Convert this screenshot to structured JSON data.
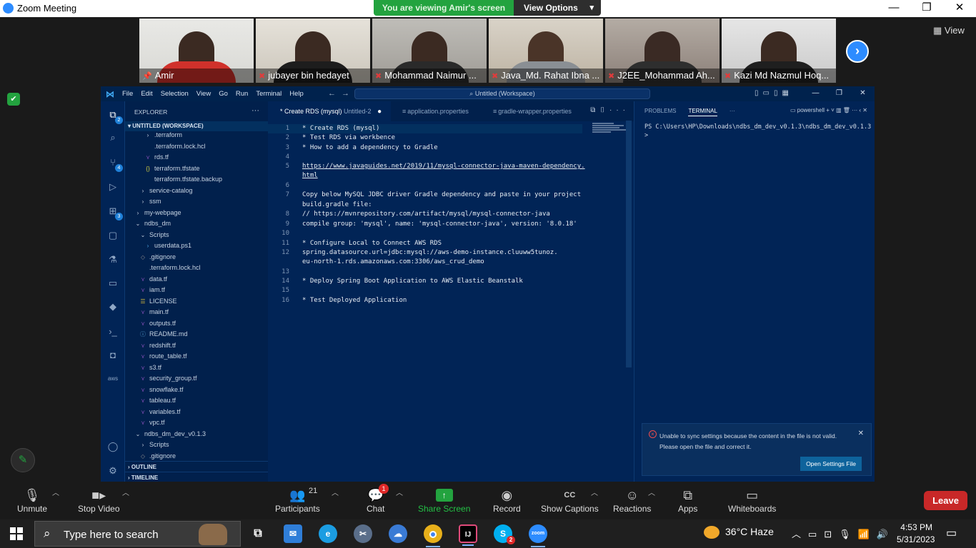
{
  "window": {
    "title": "Zoom Meeting",
    "controls": [
      "—",
      "❐",
      "✕"
    ]
  },
  "banner": {
    "viewing_text": "You are viewing Amir's screen",
    "view_options_label": "View Options"
  },
  "view_button": "View",
  "participants": [
    {
      "name": "Amir",
      "muted": false,
      "pinned": true
    },
    {
      "name": "jubayer bin hedayet",
      "muted": true
    },
    {
      "name": "Mohammad Naimur ...",
      "muted": true
    },
    {
      "name": "Java_Md. Rahat Ibna ...",
      "muted": true
    },
    {
      "name": "J2EE_Mohammad Ah...",
      "muted": true
    },
    {
      "name": "Kazi Md Nazmul Hoq...",
      "muted": true
    }
  ],
  "vscode": {
    "menu": [
      "File",
      "Edit",
      "Selection",
      "View",
      "Go",
      "Run",
      "Terminal",
      "Help"
    ],
    "command_center": "Untitled (Workspace)",
    "activity_badges": {
      "explorer": "2",
      "scm": "4",
      "extensions": "3"
    },
    "explorer_title": "EXPLORER",
    "workspace_section": "UNTITLED (WORKSPACE)",
    "tree": [
      {
        "label": ".terraform",
        "indent": 2,
        "icon": "chevron-right"
      },
      {
        "label": ".terraform.lock.hcl",
        "indent": 2,
        "icon": "file"
      },
      {
        "label": "rds.tf",
        "indent": 2,
        "icon": "terraform"
      },
      {
        "label": "terraform.tfstate",
        "indent": 2,
        "icon": "json"
      },
      {
        "label": "terraform.tfstate.backup",
        "indent": 2,
        "icon": "file"
      },
      {
        "label": "service-catalog",
        "indent": 1,
        "icon": "chevron-right"
      },
      {
        "label": "ssm",
        "indent": 1,
        "icon": "chevron-right"
      },
      {
        "label": "my-webpage",
        "indent": 0,
        "icon": "chevron-right"
      },
      {
        "label": "ndbs_dm",
        "indent": 0,
        "icon": "chevron-down"
      },
      {
        "label": "Scripts",
        "indent": 1,
        "icon": "chevron-down"
      },
      {
        "label": "userdata.ps1",
        "indent": 2,
        "icon": "powershell"
      },
      {
        "label": ".gitignore",
        "indent": 1,
        "icon": "git"
      },
      {
        "label": ".terraform.lock.hcl",
        "indent": 1,
        "icon": "file"
      },
      {
        "label": "data.tf",
        "indent": 1,
        "icon": "terraform"
      },
      {
        "label": "iam.tf",
        "indent": 1,
        "icon": "terraform"
      },
      {
        "label": "LICENSE",
        "indent": 1,
        "icon": "license"
      },
      {
        "label": "main.tf",
        "indent": 1,
        "icon": "terraform"
      },
      {
        "label": "outputs.tf",
        "indent": 1,
        "icon": "terraform"
      },
      {
        "label": "README.md",
        "indent": 1,
        "icon": "markdown"
      },
      {
        "label": "redshift.tf",
        "indent": 1,
        "icon": "terraform"
      },
      {
        "label": "route_table.tf",
        "indent": 1,
        "icon": "terraform"
      },
      {
        "label": "s3.tf",
        "indent": 1,
        "icon": "terraform"
      },
      {
        "label": "security_group.tf",
        "indent": 1,
        "icon": "terraform"
      },
      {
        "label": "snowflake.tf",
        "indent": 1,
        "icon": "terraform"
      },
      {
        "label": "tableau.tf",
        "indent": 1,
        "icon": "terraform"
      },
      {
        "label": "variables.tf",
        "indent": 1,
        "icon": "terraform"
      },
      {
        "label": "vpc.tf",
        "indent": 1,
        "icon": "terraform"
      },
      {
        "label": "ndbs_dm_dev_v0.1.3",
        "indent": 0,
        "icon": "chevron-down"
      },
      {
        "label": "Scripts",
        "indent": 1,
        "icon": "chevron-right"
      },
      {
        "label": ".gitignore",
        "indent": 1,
        "icon": "git"
      }
    ],
    "outline_label": "OUTLINE",
    "timeline_label": "TIMELINE",
    "tabs": [
      {
        "label": "* Create RDS (mysql)",
        "suffix": "Untitled-2",
        "active": true,
        "dirty": true
      },
      {
        "label": "application.properties",
        "active": false
      },
      {
        "label": "gradle-wrapper.properties",
        "active": false
      }
    ],
    "code_lines": [
      {
        "n": "1",
        "text": "* Create RDS (mysql)",
        "current": true
      },
      {
        "n": "2",
        "text": "* Test RDS via workbence"
      },
      {
        "n": "3",
        "text": "* How to add a dependency to Gradle"
      },
      {
        "n": "4",
        "text": ""
      },
      {
        "n": "5",
        "text": "https://www.javaguides.net/2019/11/mysql-connector-java-maven-dependency.",
        "link": true
      },
      {
        "n": "",
        "text": "html",
        "link": true
      },
      {
        "n": "6",
        "text": ""
      },
      {
        "n": "7",
        "text": "Copy below MySQL JDBC driver Gradle dependency and paste in your project"
      },
      {
        "n": "",
        "text": "build.gradle file:"
      },
      {
        "n": "8",
        "text": "// https://mvnrepository.com/artifact/mysql/mysql-connector-java",
        "comment_link": true
      },
      {
        "n": "9",
        "text": "compile group: 'mysql', name: 'mysql-connector-java', version: '8.0.18'"
      },
      {
        "n": "10",
        "text": ""
      },
      {
        "n": "11",
        "text": "* Configure Local to Connect AWS RDS"
      },
      {
        "n": "12",
        "text": "spring.datasource.url=jdbc:mysql://aws-demo-instance.cluuww5tunoz."
      },
      {
        "n": "",
        "text": "eu-north-1.rds.amazonaws.com:3306/aws_crud_demo"
      },
      {
        "n": "13",
        "text": ""
      },
      {
        "n": "14",
        "text": "* Deploy Spring Boot Application to AWS Elastic Beanstalk"
      },
      {
        "n": "15",
        "text": ""
      },
      {
        "n": "16",
        "text": "* Test Deployed Application"
      }
    ],
    "panel_tabs": [
      "PROBLEMS",
      "TERMINAL"
    ],
    "panel_shell": "powershell",
    "terminal_lines": [
      "PS C:\\Users\\HP\\Downloads\\ndbs_dm_dev_v0.1.3\\ndbs_dm_dev_v0.1.3",
      ">"
    ],
    "notification": {
      "message_line1": "Unable to sync settings because the content in the file is not valid.",
      "message_line2": "Please open the file and correct it.",
      "button": "Open Settings File"
    }
  },
  "toolbar": {
    "unmute": "Unmute",
    "stop_video": "Stop Video",
    "participants": "Participants",
    "participants_count": "21",
    "chat": "Chat",
    "chat_badge": "1",
    "share_screen": "Share Screen",
    "record": "Record",
    "show_captions": "Show Captions",
    "captions_icon": "CC",
    "reactions": "Reactions",
    "apps": "Apps",
    "whiteboards": "Whiteboards",
    "leave": "Leave"
  },
  "taskbar": {
    "search_placeholder": "Type here to search",
    "intellij_label": "IJ",
    "skype_badge": "2",
    "zoom_label": "zoom",
    "weather": "36°C  Haze",
    "time": "4:53 PM",
    "date": "5/31/2023"
  },
  "colors": {
    "vscode_bg": "#012456",
    "zoom_green": "#23a33f",
    "zoom_blue": "#2d8cff",
    "leave_red": "#c82828"
  }
}
